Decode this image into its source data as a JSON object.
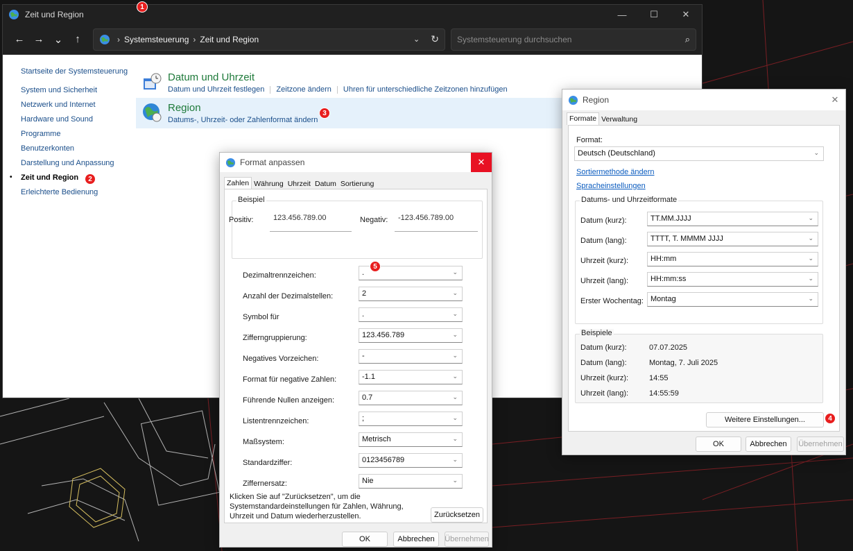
{
  "window": {
    "title": "Zeit und Region",
    "controls": {
      "minimize": "—",
      "maximize": "☐",
      "close": "✕"
    }
  },
  "nav": {
    "back": "←",
    "forward": "→",
    "recent": "⌄",
    "up": "↑",
    "breadcrumb_root": "Systemsteuerung",
    "breadcrumb_current": "Zeit und Region",
    "breadcrumb_sep": "›",
    "dropdown": "⌄",
    "refresh": "↻",
    "search_placeholder": "Systemsteuerung durchsuchen",
    "search_icon": "⌕"
  },
  "sidebar": {
    "home": "Startseite der Systemsteuerung",
    "items": [
      {
        "label": "System und Sicherheit"
      },
      {
        "label": "Netzwerk und Internet"
      },
      {
        "label": "Hardware und Sound"
      },
      {
        "label": "Programme"
      },
      {
        "label": "Benutzerkonten"
      },
      {
        "label": "Darstellung und Anpassung"
      },
      {
        "label": "Zeit und Region"
      },
      {
        "label": "Erleichterte Bedienung"
      }
    ],
    "bullet": "•"
  },
  "categories": {
    "datetime": {
      "title": "Datum und Uhrzeit",
      "link1": "Datum und Uhrzeit festlegen",
      "link2": "Zeitzone ändern",
      "link3": "Uhren für unterschiedliche Zeitzonen hinzufügen"
    },
    "region": {
      "title": "Region",
      "link1": "Datums-, Uhrzeit- oder Zahlenformat ändern"
    }
  },
  "badges": {
    "b1": "1",
    "b2": "2",
    "b3": "3",
    "b4": "4",
    "b5": "5"
  },
  "format_dialog": {
    "title": "Format anpassen",
    "close": "✕",
    "tabs": [
      "Zahlen",
      "Währung",
      "Uhrzeit",
      "Datum",
      "Sortierung"
    ],
    "example_legend": "Beispiel",
    "positive_label": "Positiv:",
    "positive_value": "123.456.789.00",
    "negative_label": "Negativ:",
    "negative_value": "-123.456.789.00",
    "rows": [
      {
        "label": "Dezimaltrennzeichen:",
        "value": "."
      },
      {
        "label": "Anzahl der Dezimalstellen:",
        "value": "2"
      },
      {
        "label": "Symbol für",
        "value": "."
      },
      {
        "label": "Zifferngruppierung:",
        "value": "123.456.789"
      },
      {
        "label": "Negatives Vorzeichen:",
        "value": "-"
      },
      {
        "label": "Format für negative Zahlen:",
        "value": "-1.1"
      },
      {
        "label": "Führende Nullen anzeigen:",
        "value": "0.7"
      },
      {
        "label": "Listentrennzeichen:",
        "value": ";"
      },
      {
        "label": "Maßsystem:",
        "value": "Metrisch"
      },
      {
        "label": "Standardziffer:",
        "value": "0123456789"
      },
      {
        "label": "Ziffernersatz:",
        "value": "Nie"
      }
    ],
    "reset_text": "Klicken Sie auf \"Zurücksetzen\", um die Systemstandardeinstellungen für Zahlen, Währung, Uhrzeit und Datum wiederherzustellen.",
    "reset_button": "Zurücksetzen",
    "ok": "OK",
    "cancel": "Abbrechen",
    "apply": "Übernehmen",
    "chev": "⌄"
  },
  "region_dialog": {
    "title": "Region",
    "close": "✕",
    "tabs": [
      "Formate",
      "Verwaltung"
    ],
    "format_label": "Format:",
    "format_value": "Deutsch (Deutschland)",
    "link_sort": "Sortiermethode ändern",
    "link_lang": "Spracheinstellungen",
    "formats_legend": "Datums- und Uhrzeitformate",
    "formats": [
      {
        "label": "Datum (kurz):",
        "value": "TT.MM.JJJJ"
      },
      {
        "label": "Datum (lang):",
        "value": "TTTT, T. MMMM JJJJ"
      },
      {
        "label": "Uhrzeit (kurz):",
        "value": "HH:mm"
      },
      {
        "label": "Uhrzeit (lang):",
        "value": "HH:mm:ss"
      },
      {
        "label": "Erster Wochentag:",
        "value": "Montag"
      }
    ],
    "examples_legend": "Beispiele",
    "examples": [
      {
        "label": "Datum (kurz):",
        "value": "07.07.2025"
      },
      {
        "label": "Datum (lang):",
        "value": "Montag, 7. Juli 2025"
      },
      {
        "label": "Uhrzeit (kurz):",
        "value": "14:55"
      },
      {
        "label": "Uhrzeit (lang):",
        "value": "14:55:59"
      }
    ],
    "more_button": "Weitere Einstellungen...",
    "ok": "OK",
    "cancel": "Abbrechen",
    "apply": "Übernehmen",
    "chev": "⌄"
  }
}
